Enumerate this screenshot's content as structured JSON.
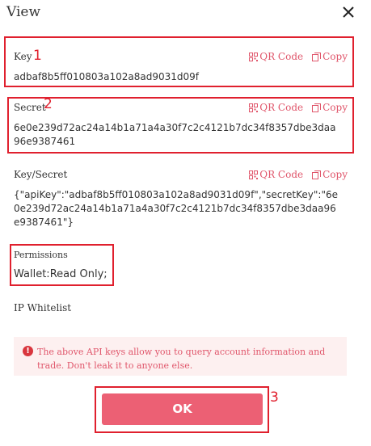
{
  "dialog": {
    "title": "View"
  },
  "actions": {
    "qr_label": "QR Code",
    "copy_label": "Copy"
  },
  "key": {
    "label": "Key",
    "value": "adbaf8b5ff010803a102a8ad9031d09f"
  },
  "secret": {
    "label": "Secret",
    "line1": "6e0e239d72ac24a14b1a71a4a30f7c2c4121b7dc34f8357dbe3daa",
    "line2": "96e9387461"
  },
  "key_secret": {
    "label": "Key/Secret",
    "line1": "{\"apiKey\":\"adbaf8b5ff010803a102a8ad9031d09f\",\"secretKey\":\"6e",
    "line2": "0e239d72ac24a14b1a71a4a30f7c2c4121b7dc34f8357dbe3daa96",
    "line3": "e9387461\"}"
  },
  "permissions": {
    "label": "Permissions",
    "value": "Wallet:Read Only;"
  },
  "ip_whitelist": {
    "label": "IP Whitelist"
  },
  "warning": {
    "text": "The above API keys allow you to query account information and trade. Don't leak it to anyone else."
  },
  "ok_button": {
    "label": "OK"
  },
  "annotations": [
    "1",
    "2",
    "3"
  ],
  "colors": {
    "accent": "#e0566b",
    "annotation": "#e0202e",
    "ok_button": "#ec6074",
    "warning_bg": "#fdf0f0"
  }
}
